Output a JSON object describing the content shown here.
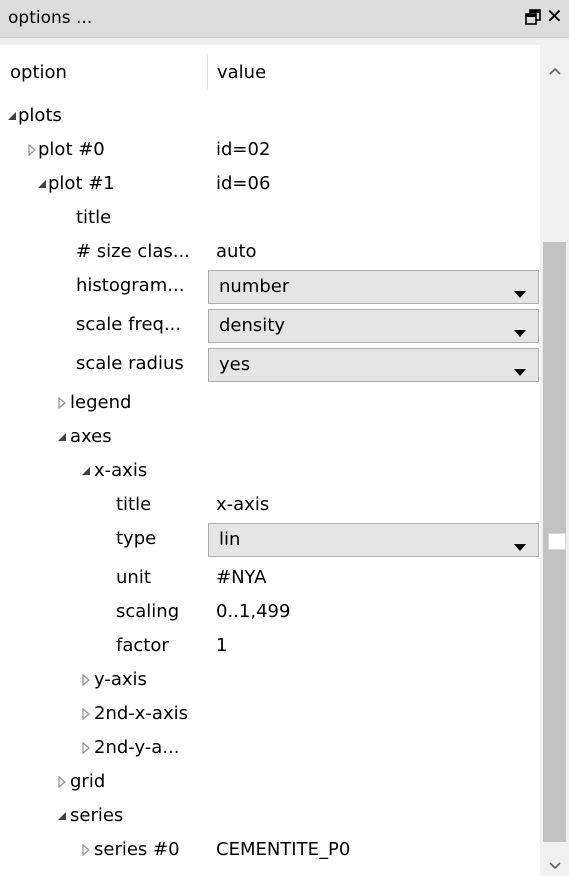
{
  "window": {
    "title": "options ..."
  },
  "columns": {
    "option": "option",
    "value": "value"
  },
  "rows": [
    {
      "label": "plots",
      "value": "",
      "expander": "expanded"
    },
    {
      "label": "plot #0",
      "value": "id=02",
      "expander": "collapsed"
    },
    {
      "label": "plot #1",
      "value": "id=06",
      "expander": "expanded"
    },
    {
      "label": "title",
      "value": "",
      "expander": "none"
    },
    {
      "label": "# size clas...",
      "value": "auto",
      "expander": "none"
    },
    {
      "label": "histogram...",
      "value": "number",
      "expander": "none",
      "dropdown": true
    },
    {
      "label": "scale freq...",
      "value": "density",
      "expander": "none",
      "dropdown": true
    },
    {
      "label": "scale radius",
      "value": "yes",
      "expander": "none",
      "dropdown": true
    },
    {
      "label": "legend",
      "value": "",
      "expander": "collapsed"
    },
    {
      "label": "axes",
      "value": "",
      "expander": "expanded"
    },
    {
      "label": "x-axis",
      "value": "",
      "expander": "expanded"
    },
    {
      "label": "title",
      "value": "x-axis",
      "expander": "none"
    },
    {
      "label": "type",
      "value": "lin",
      "expander": "none",
      "dropdown": true
    },
    {
      "label": "unit",
      "value": "#NYA",
      "expander": "none"
    },
    {
      "label": "scaling",
      "value": "0..1,499",
      "expander": "none"
    },
    {
      "label": "factor",
      "value": "1",
      "expander": "none"
    },
    {
      "label": "y-axis",
      "value": "",
      "expander": "collapsed"
    },
    {
      "label": "2nd-x-axis",
      "value": "",
      "expander": "collapsed"
    },
    {
      "label": "2nd-y-a...",
      "value": "",
      "expander": "collapsed"
    },
    {
      "label": "grid",
      "value": "",
      "expander": "collapsed"
    },
    {
      "label": "series",
      "value": "",
      "expander": "expanded"
    },
    {
      "label": "series #0",
      "value": "CEMENTITE_P0",
      "expander": "collapsed"
    }
  ],
  "icons": {
    "float": "float-window-icon",
    "close": "close-icon",
    "expanded": "expanded-triangle-icon",
    "collapsed": "collapsed-triangle-icon",
    "dropdown": "dropdown-arrow-icon",
    "scroll_up": "scroll-up-icon",
    "scroll_down": "scroll-down-icon"
  },
  "colors": {
    "titlebar": "#dcdcdc",
    "panel": "#ffffff",
    "combo": "#e5e5e5",
    "scroll_thumb": "#c2c2c2"
  }
}
